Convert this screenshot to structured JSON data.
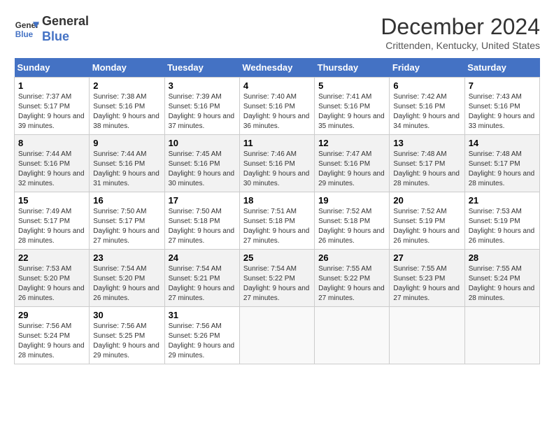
{
  "header": {
    "logo_line1": "General",
    "logo_line2": "Blue",
    "month_year": "December 2024",
    "location": "Crittenden, Kentucky, United States"
  },
  "weekdays": [
    "Sunday",
    "Monday",
    "Tuesday",
    "Wednesday",
    "Thursday",
    "Friday",
    "Saturday"
  ],
  "weeks": [
    [
      {
        "day": "1",
        "sunrise": "Sunrise: 7:37 AM",
        "sunset": "Sunset: 5:17 PM",
        "daylight": "Daylight: 9 hours and 39 minutes."
      },
      {
        "day": "2",
        "sunrise": "Sunrise: 7:38 AM",
        "sunset": "Sunset: 5:16 PM",
        "daylight": "Daylight: 9 hours and 38 minutes."
      },
      {
        "day": "3",
        "sunrise": "Sunrise: 7:39 AM",
        "sunset": "Sunset: 5:16 PM",
        "daylight": "Daylight: 9 hours and 37 minutes."
      },
      {
        "day": "4",
        "sunrise": "Sunrise: 7:40 AM",
        "sunset": "Sunset: 5:16 PM",
        "daylight": "Daylight: 9 hours and 36 minutes."
      },
      {
        "day": "5",
        "sunrise": "Sunrise: 7:41 AM",
        "sunset": "Sunset: 5:16 PM",
        "daylight": "Daylight: 9 hours and 35 minutes."
      },
      {
        "day": "6",
        "sunrise": "Sunrise: 7:42 AM",
        "sunset": "Sunset: 5:16 PM",
        "daylight": "Daylight: 9 hours and 34 minutes."
      },
      {
        "day": "7",
        "sunrise": "Sunrise: 7:43 AM",
        "sunset": "Sunset: 5:16 PM",
        "daylight": "Daylight: 9 hours and 33 minutes."
      }
    ],
    [
      {
        "day": "8",
        "sunrise": "Sunrise: 7:44 AM",
        "sunset": "Sunset: 5:16 PM",
        "daylight": "Daylight: 9 hours and 32 minutes."
      },
      {
        "day": "9",
        "sunrise": "Sunrise: 7:44 AM",
        "sunset": "Sunset: 5:16 PM",
        "daylight": "Daylight: 9 hours and 31 minutes."
      },
      {
        "day": "10",
        "sunrise": "Sunrise: 7:45 AM",
        "sunset": "Sunset: 5:16 PM",
        "daylight": "Daylight: 9 hours and 30 minutes."
      },
      {
        "day": "11",
        "sunrise": "Sunrise: 7:46 AM",
        "sunset": "Sunset: 5:16 PM",
        "daylight": "Daylight: 9 hours and 30 minutes."
      },
      {
        "day": "12",
        "sunrise": "Sunrise: 7:47 AM",
        "sunset": "Sunset: 5:16 PM",
        "daylight": "Daylight: 9 hours and 29 minutes."
      },
      {
        "day": "13",
        "sunrise": "Sunrise: 7:48 AM",
        "sunset": "Sunset: 5:17 PM",
        "daylight": "Daylight: 9 hours and 28 minutes."
      },
      {
        "day": "14",
        "sunrise": "Sunrise: 7:48 AM",
        "sunset": "Sunset: 5:17 PM",
        "daylight": "Daylight: 9 hours and 28 minutes."
      }
    ],
    [
      {
        "day": "15",
        "sunrise": "Sunrise: 7:49 AM",
        "sunset": "Sunset: 5:17 PM",
        "daylight": "Daylight: 9 hours and 28 minutes."
      },
      {
        "day": "16",
        "sunrise": "Sunrise: 7:50 AM",
        "sunset": "Sunset: 5:17 PM",
        "daylight": "Daylight: 9 hours and 27 minutes."
      },
      {
        "day": "17",
        "sunrise": "Sunrise: 7:50 AM",
        "sunset": "Sunset: 5:18 PM",
        "daylight": "Daylight: 9 hours and 27 minutes."
      },
      {
        "day": "18",
        "sunrise": "Sunrise: 7:51 AM",
        "sunset": "Sunset: 5:18 PM",
        "daylight": "Daylight: 9 hours and 27 minutes."
      },
      {
        "day": "19",
        "sunrise": "Sunrise: 7:52 AM",
        "sunset": "Sunset: 5:18 PM",
        "daylight": "Daylight: 9 hours and 26 minutes."
      },
      {
        "day": "20",
        "sunrise": "Sunrise: 7:52 AM",
        "sunset": "Sunset: 5:19 PM",
        "daylight": "Daylight: 9 hours and 26 minutes."
      },
      {
        "day": "21",
        "sunrise": "Sunrise: 7:53 AM",
        "sunset": "Sunset: 5:19 PM",
        "daylight": "Daylight: 9 hours and 26 minutes."
      }
    ],
    [
      {
        "day": "22",
        "sunrise": "Sunrise: 7:53 AM",
        "sunset": "Sunset: 5:20 PM",
        "daylight": "Daylight: 9 hours and 26 minutes."
      },
      {
        "day": "23",
        "sunrise": "Sunrise: 7:54 AM",
        "sunset": "Sunset: 5:20 PM",
        "daylight": "Daylight: 9 hours and 26 minutes."
      },
      {
        "day": "24",
        "sunrise": "Sunrise: 7:54 AM",
        "sunset": "Sunset: 5:21 PM",
        "daylight": "Daylight: 9 hours and 27 minutes."
      },
      {
        "day": "25",
        "sunrise": "Sunrise: 7:54 AM",
        "sunset": "Sunset: 5:22 PM",
        "daylight": "Daylight: 9 hours and 27 minutes."
      },
      {
        "day": "26",
        "sunrise": "Sunrise: 7:55 AM",
        "sunset": "Sunset: 5:22 PM",
        "daylight": "Daylight: 9 hours and 27 minutes."
      },
      {
        "day": "27",
        "sunrise": "Sunrise: 7:55 AM",
        "sunset": "Sunset: 5:23 PM",
        "daylight": "Daylight: 9 hours and 27 minutes."
      },
      {
        "day": "28",
        "sunrise": "Sunrise: 7:55 AM",
        "sunset": "Sunset: 5:24 PM",
        "daylight": "Daylight: 9 hours and 28 minutes."
      }
    ],
    [
      {
        "day": "29",
        "sunrise": "Sunrise: 7:56 AM",
        "sunset": "Sunset: 5:24 PM",
        "daylight": "Daylight: 9 hours and 28 minutes."
      },
      {
        "day": "30",
        "sunrise": "Sunrise: 7:56 AM",
        "sunset": "Sunset: 5:25 PM",
        "daylight": "Daylight: 9 hours and 29 minutes."
      },
      {
        "day": "31",
        "sunrise": "Sunrise: 7:56 AM",
        "sunset": "Sunset: 5:26 PM",
        "daylight": "Daylight: 9 hours and 29 minutes."
      },
      null,
      null,
      null,
      null
    ]
  ]
}
